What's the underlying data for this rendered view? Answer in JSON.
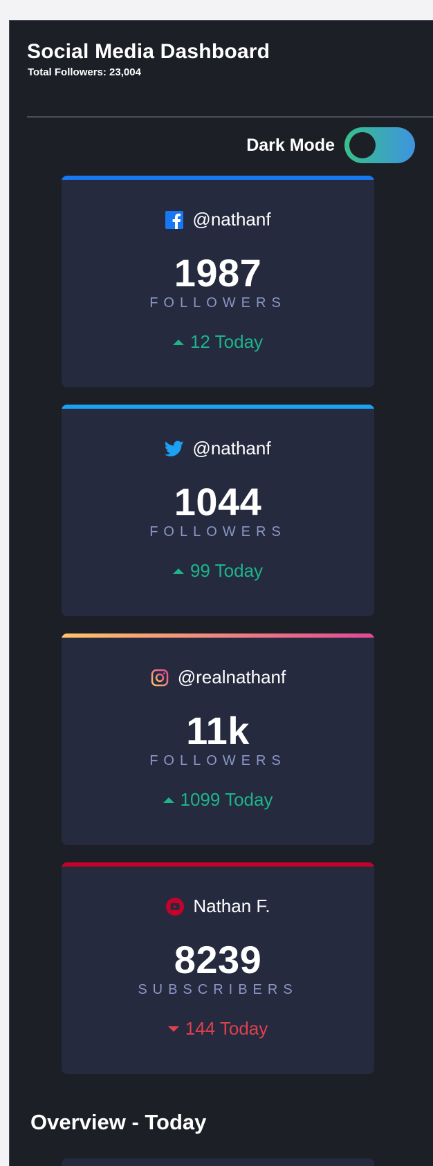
{
  "header": {
    "title": "Social Media Dashboard",
    "total_followers": "Total Followers: 23,004"
  },
  "toggle": {
    "label": "Dark Mode",
    "on": true
  },
  "colors": {
    "facebook": "#1877f2",
    "twitter": "#1da1f2",
    "instagram_start": "#fdc468",
    "instagram_end": "#df4996",
    "youtube": "#c4032b",
    "up": "#1db489",
    "down": "#dc414c"
  },
  "cards": [
    {
      "platform": "facebook",
      "icon": "facebook-icon",
      "handle": "@nathanf",
      "count": "1987",
      "unit": "FOLLOWERS",
      "direction": "up",
      "change": "12 Today"
    },
    {
      "platform": "twitter",
      "icon": "twitter-icon",
      "handle": "@nathanf",
      "count": "1044",
      "unit": "FOLLOWERS",
      "direction": "up",
      "change": "99 Today"
    },
    {
      "platform": "instagram",
      "icon": "instagram-icon",
      "handle": "@realnathanf",
      "count": "11k",
      "unit": "FOLLOWERS",
      "direction": "up",
      "change": "1099 Today"
    },
    {
      "platform": "youtube",
      "icon": "youtube-icon",
      "handle": "Nathan F.",
      "count": "8239",
      "unit": "SUBSCRIBERS",
      "direction": "down",
      "change": "144 Today"
    }
  ],
  "overview": {
    "title": "Overview - Today"
  }
}
